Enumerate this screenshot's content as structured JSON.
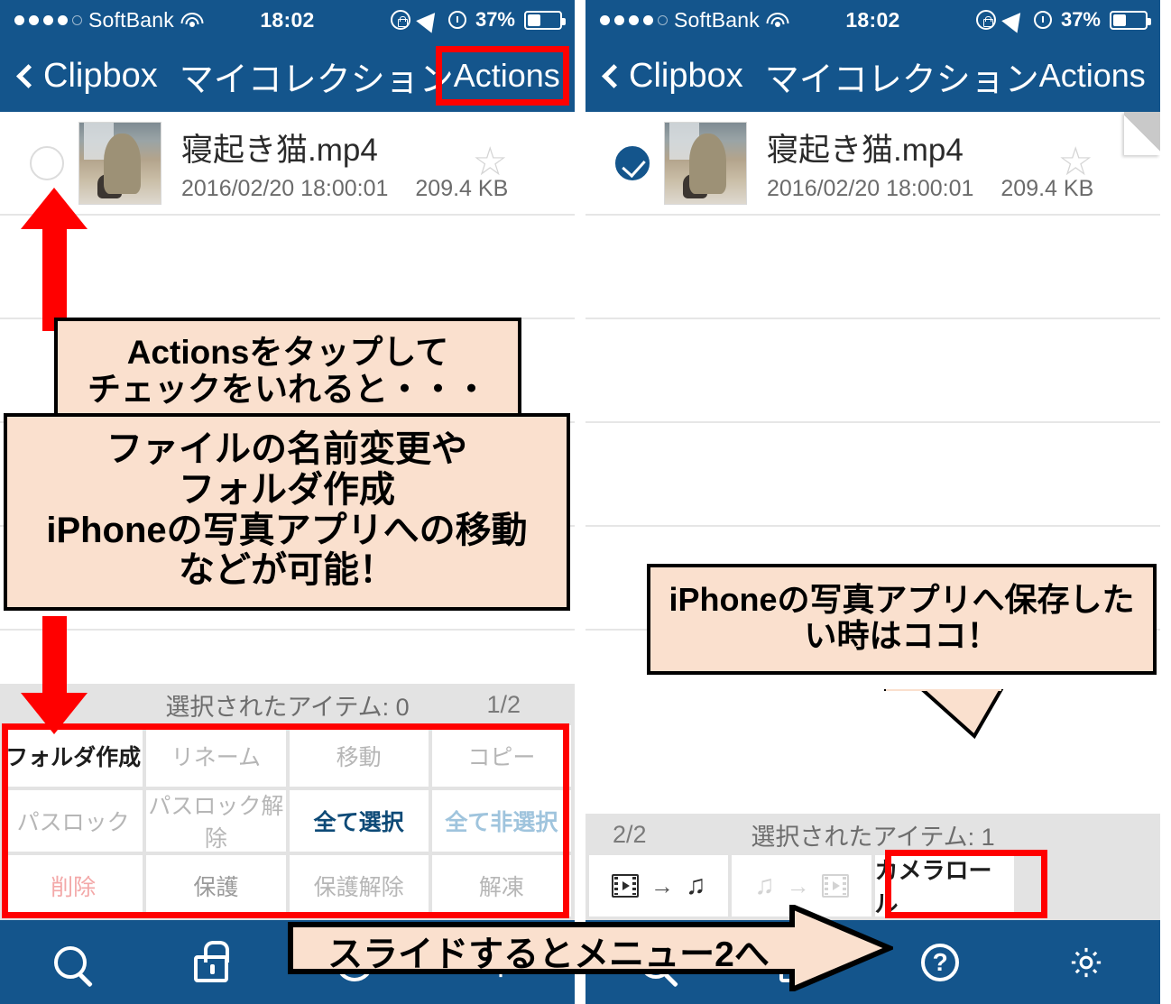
{
  "statusbar": {
    "carrier": "SoftBank",
    "time": "18:02",
    "battery_pct": "37%",
    "icons": [
      "signal-dots",
      "wifi-icon",
      "rotation-lock-icon",
      "location-arrow-icon",
      "alarm-clock-icon",
      "battery-icon"
    ]
  },
  "navbar": {
    "back_label": "Clipbox",
    "title": "マイコレクション",
    "action_label": "Actions"
  },
  "file_row": {
    "name": "寝起き猫.mp4",
    "date": "2016/02/20 18:00:01",
    "size": "209.4 KB"
  },
  "left_sheet": {
    "page": "1/2",
    "selected_label": "選択されたアイテム: 0",
    "buttons": [
      {
        "label": "フォルダ作成",
        "state": "enabled"
      },
      {
        "label": "リネーム",
        "state": "disabled"
      },
      {
        "label": "移動",
        "state": "disabled"
      },
      {
        "label": "コピー",
        "state": "disabled"
      },
      {
        "label": "パスロック",
        "state": "disabled"
      },
      {
        "label": "パスロック解除",
        "state": "disabled"
      },
      {
        "label": "全て選択",
        "state": "blue"
      },
      {
        "label": "全て非選択",
        "state": "blue-dim"
      },
      {
        "label": "削除",
        "state": "delete-disabled"
      },
      {
        "label": "保護",
        "state": "gray"
      },
      {
        "label": "保護解除",
        "state": "disabled"
      },
      {
        "label": "解凍",
        "state": "disabled"
      }
    ]
  },
  "right_sheet": {
    "page": "2/2",
    "selected_label": "選択されたアイテム: 1",
    "convert_video_to_audio": "video-to-audio-icon",
    "convert_audio_to_video": "audio-to-video-icon",
    "camera_roll_label": "カメラロール"
  },
  "tabbar": {
    "items": [
      {
        "icon": "search-icon"
      },
      {
        "icon": "lock-icon"
      },
      {
        "icon": "help-icon",
        "glyph": "?"
      },
      {
        "icon": "gear-icon"
      }
    ]
  },
  "callouts": {
    "c1_line1": "Actionsをタップして",
    "c1_line2": "チェックをいれると・・・",
    "c2_line1": "ファイルの名前変更や",
    "c2_line2": "フォルダ作成",
    "c2_line3": "iPhoneの写真アプリへの移動",
    "c2_line4": "などが可能！",
    "c3_line1": "iPhoneの写真アプリへ保存した",
    "c3_line2": "い時はココ！",
    "banner": "スライドするとメニュー2へ"
  },
  "colors": {
    "nav_blue": "#14558c",
    "highlight_red": "#ff0000",
    "callout_fill": "#fae0ce",
    "sheet_bg": "#e3e3e3"
  }
}
